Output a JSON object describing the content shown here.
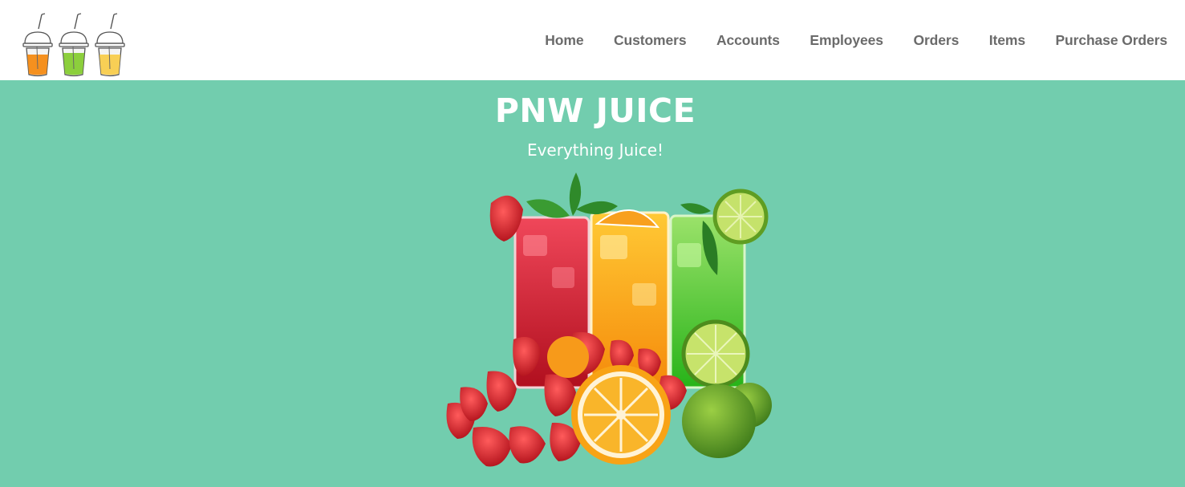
{
  "header": {
    "logo_icon": "juice-cups-logo-icon",
    "nav": [
      {
        "label": "Home"
      },
      {
        "label": "Customers"
      },
      {
        "label": "Accounts"
      },
      {
        "label": "Employees"
      },
      {
        "label": "Orders"
      },
      {
        "label": "Items"
      },
      {
        "label": "Purchase Orders"
      }
    ]
  },
  "hero": {
    "title": "PNW JUICE",
    "subtitle": "Everything Juice!",
    "image_icon": "juice-glasses-with-fruit-image"
  },
  "colors": {
    "hero_background": "#72cdae",
    "header_background": "#ffffff",
    "nav_text": "#6b6b6b",
    "hero_text": "#ffffff"
  }
}
